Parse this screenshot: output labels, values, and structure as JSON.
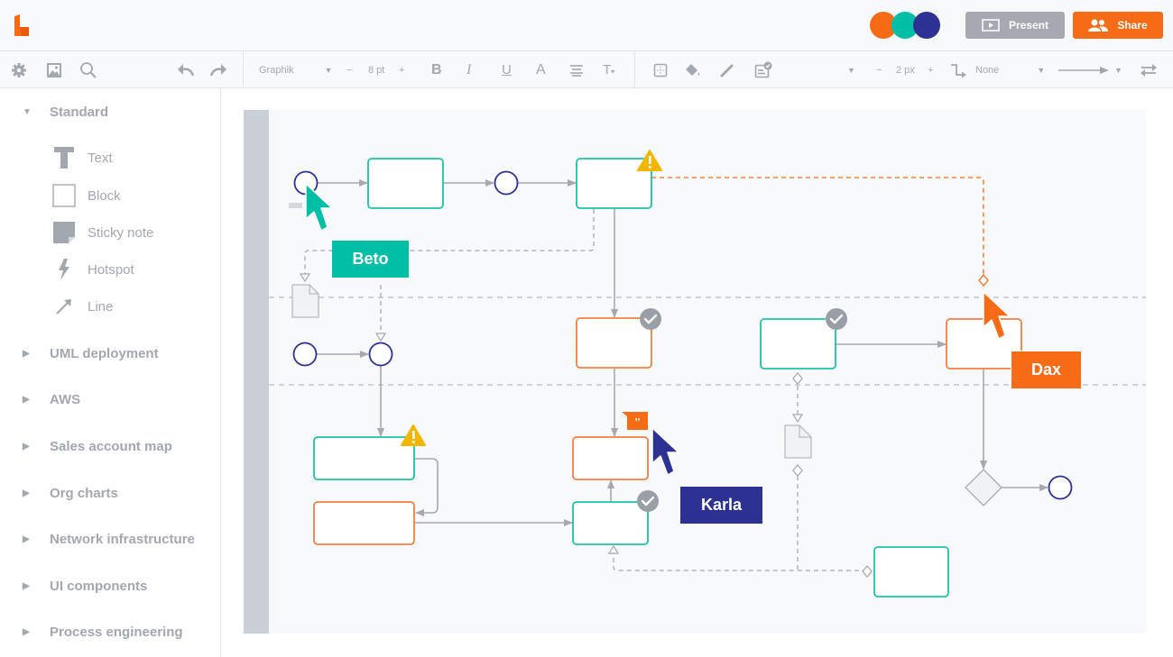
{
  "app": {
    "logo": "lucidchart-logo-icon"
  },
  "header": {
    "collaborators": [
      {
        "name": "collaborator-1",
        "color": "#f56b16"
      },
      {
        "name": "collaborator-2",
        "color": "#00bfa5"
      },
      {
        "name": "collaborator-3",
        "color": "#2d3192"
      }
    ],
    "present_label": "Present",
    "share_label": "Share"
  },
  "toolbar": {
    "font_name": "Graphik",
    "font_size": "8 pt",
    "minus": "−",
    "plus": "+",
    "line_width": "2 px",
    "line_style": "None"
  },
  "sidebar": {
    "standard_label": "Standard",
    "shapes": [
      {
        "label": "Text",
        "icon": "text-icon"
      },
      {
        "label": "Block",
        "icon": "block-icon"
      },
      {
        "label": "Sticky note",
        "icon": "sticky-note-icon"
      },
      {
        "label": "Hotspot",
        "icon": "hotspot-icon"
      },
      {
        "label": "Line",
        "icon": "line-icon"
      }
    ],
    "sections": [
      {
        "label": "UML deployment"
      },
      {
        "label": "AWS"
      },
      {
        "label": "Sales account map"
      },
      {
        "label": "Org charts"
      },
      {
        "label": "Network infrastructure"
      },
      {
        "label": "UI components"
      },
      {
        "label": "Process engineering"
      }
    ]
  },
  "colors": {
    "teal": "#1cc3a8",
    "orange": "#f56b16",
    "navy": "#2d3192",
    "gray": "#a6a9b1",
    "warning": "#f2b600"
  },
  "cursors": [
    {
      "name": "Beto",
      "color": "#00bfa5"
    },
    {
      "name": "Dax",
      "color": "#f56b16"
    },
    {
      "name": "Karla",
      "color": "#2d3192"
    }
  ]
}
